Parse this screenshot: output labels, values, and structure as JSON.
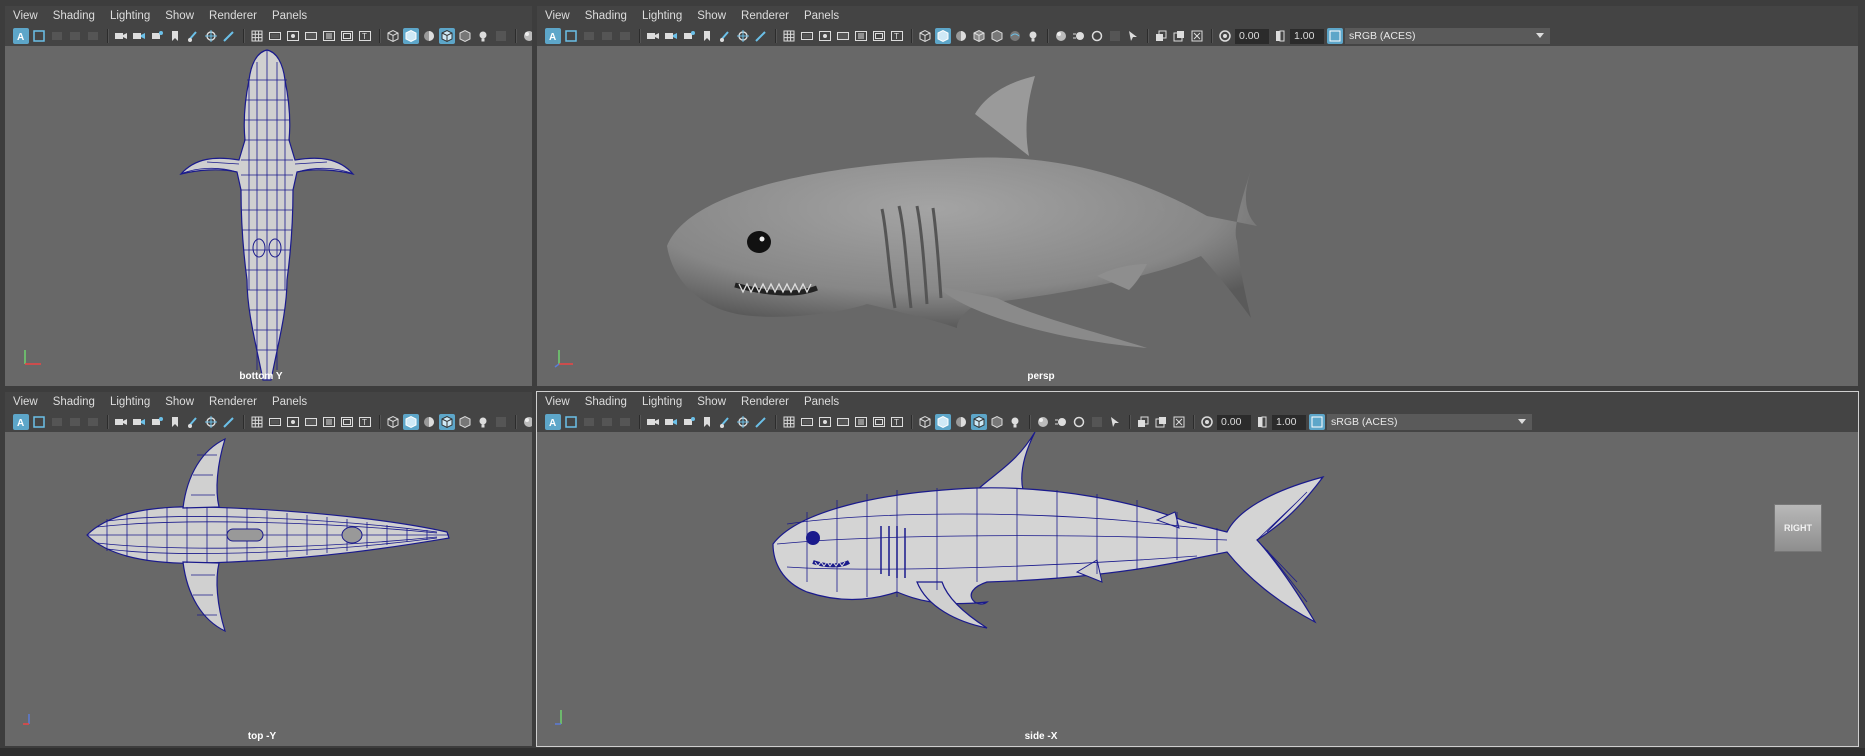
{
  "menu": [
    "View",
    "Shading",
    "Lighting",
    "Show",
    "Renderer",
    "Panels"
  ],
  "panels": {
    "bottom": {
      "label": "bottom Y"
    },
    "persp": {
      "label": "persp",
      "near": "0.00",
      "far": "1.00",
      "colorspace": "sRGB (ACES)"
    },
    "top": {
      "label": "top -Y"
    },
    "side": {
      "label": "side -X",
      "near": "0.00",
      "far": "1.00",
      "colorspace": "sRGB (ACES)",
      "viewcube": "RIGHT"
    }
  },
  "icons": [
    "select-camera-icon",
    "camera-attributes-icon",
    "bookmark-icon",
    "image-plane-icon",
    "2d-pan-zoom-icon",
    "grease-pencil-icon",
    "grid-icon",
    "film-gate-icon",
    "resolution-gate-icon",
    "gate-mask-icon",
    "field-chart-icon",
    "safe-action-icon",
    "safe-title-icon",
    "wireframe-icon",
    "smooth-shade-icon",
    "use-default-material-icon",
    "wireframe-on-shaded-icon",
    "xray-icon",
    "textured-icon",
    "use-all-lights-icon",
    "shadows-icon",
    "screen-space-ao-icon",
    "motion-blur-icon",
    "isolate-select-icon",
    "xray-joints-icon",
    "exposure-icon",
    "gamma-icon"
  ],
  "colors": {
    "accent": "#5da6c9",
    "viewport_bg": "#686868",
    "wire": "#1a1a8c"
  }
}
